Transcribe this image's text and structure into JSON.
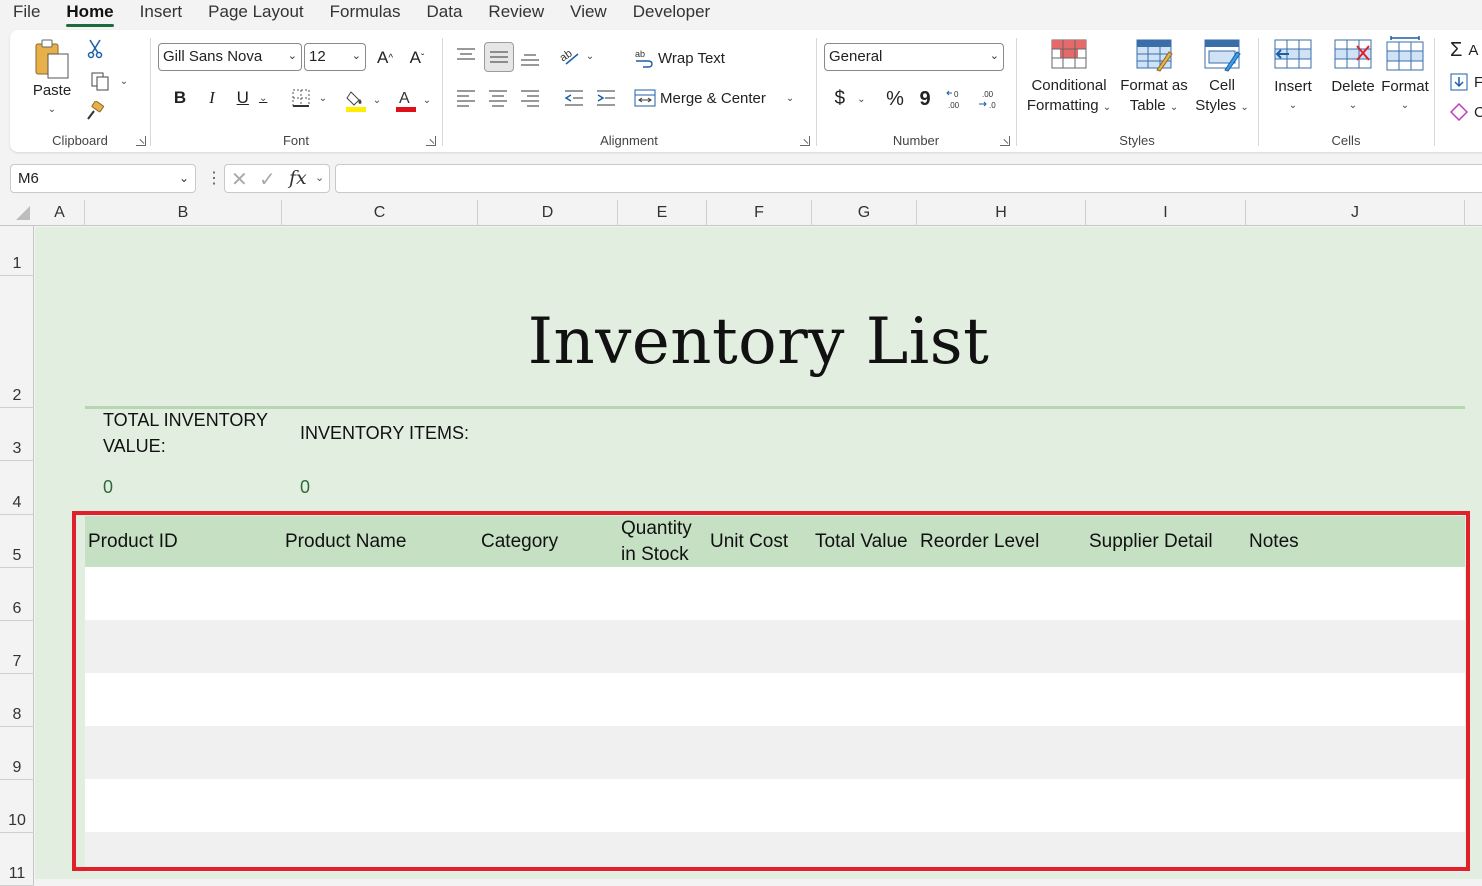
{
  "menu": {
    "tabs": [
      "File",
      "Home",
      "Insert",
      "Page Layout",
      "Formulas",
      "Data",
      "Review",
      "View",
      "Developer"
    ],
    "active": "Home"
  },
  "ribbon": {
    "clipboard": {
      "label": "Clipboard",
      "paste": "Paste"
    },
    "font": {
      "label": "Font",
      "family": "Gill Sans Nova",
      "size": "12",
      "bold": "B",
      "italic": "I",
      "underline": "U",
      "grow": "A",
      "shrink": "A"
    },
    "alignment": {
      "label": "Alignment",
      "wrap_text": "Wrap Text",
      "merge_center": "Merge & Center"
    },
    "number": {
      "label": "Number",
      "format": "General",
      "currency": "$",
      "percent": "%",
      "comma": "9"
    },
    "styles": {
      "label": "Styles",
      "conditional_1": "Conditional",
      "conditional_2": "Formatting",
      "format_table_1": "Format as",
      "format_table_2": "Table",
      "cell_styles_1": "Cell",
      "cell_styles_2": "Styles"
    },
    "cells": {
      "label": "Cells",
      "insert": "Insert",
      "delete": "Delete",
      "format": "Format"
    },
    "editing": {
      "autosum_partial": "A",
      "fill_partial": "F",
      "clear_partial": "C"
    }
  },
  "formula_bar": {
    "name_box": "M6",
    "fx": "fx",
    "content": ""
  },
  "columns": [
    "A",
    "B",
    "C",
    "D",
    "E",
    "F",
    "G",
    "H",
    "I",
    "J"
  ],
  "rows": [
    "1",
    "2",
    "3",
    "4",
    "5",
    "6",
    "7",
    "8",
    "9",
    "10",
    "11"
  ],
  "sheet": {
    "title": "Inventory List",
    "total_value_label_1": "TOTAL INVENTORY",
    "total_value_label_2": "VALUE:",
    "items_label": "INVENTORY ITEMS:",
    "total_value": "0",
    "items_count": "0",
    "headers": {
      "product_id": "Product ID",
      "product_name": "Product Name",
      "category": "Category",
      "quantity_1": "Quantity",
      "quantity_2": "in Stock",
      "unit_cost": "Unit Cost",
      "total_value": "Total Value",
      "reorder_level": "Reorder Level",
      "supplier_detail": "Supplier Detail",
      "notes": "Notes"
    }
  },
  "colors": {
    "sheet_bg": "#e2efe0",
    "header_bg": "#c6e0c4",
    "highlight": "#e0202a",
    "accent": "#1e6b3f"
  }
}
